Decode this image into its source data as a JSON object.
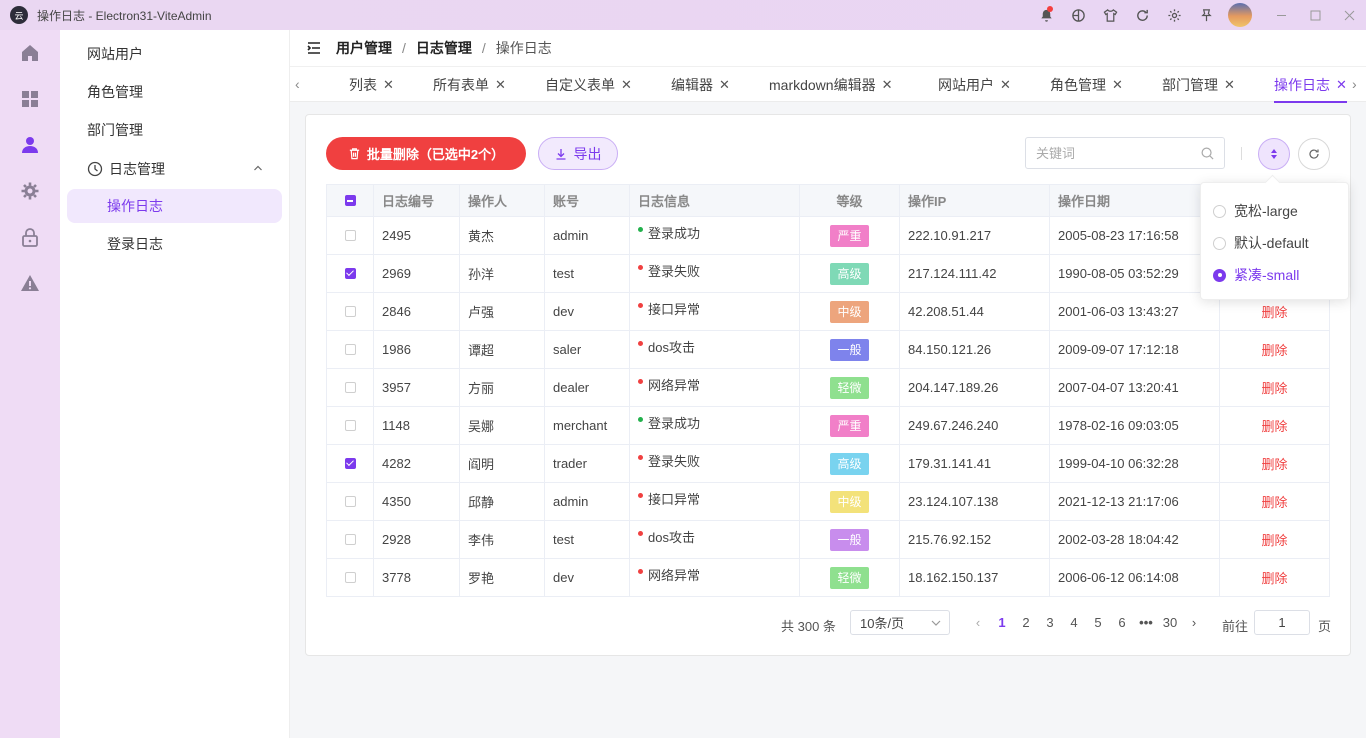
{
  "window": {
    "title": "操作日志 - Electron31-ViteAdmin",
    "logo_text": "云"
  },
  "titlebar_icons": [
    "bell-icon",
    "theme-icon",
    "shirt-icon",
    "refresh-icon",
    "gear-icon",
    "pin-icon"
  ],
  "rail": [
    "home-icon",
    "dashboard-icon",
    "user-icon",
    "gear-icon",
    "lock-icon",
    "warning-icon"
  ],
  "menu": {
    "items": [
      {
        "label": "网站用户"
      },
      {
        "label": "角色管理"
      },
      {
        "label": "部门管理"
      }
    ],
    "group": {
      "label": "日志管理",
      "expanded": true
    },
    "sub": [
      {
        "label": "操作日志",
        "active": true
      },
      {
        "label": "登录日志",
        "active": false
      }
    ]
  },
  "breadcrumb": [
    "用户管理",
    "日志管理",
    "操作日志"
  ],
  "tabs": [
    {
      "label": "列表",
      "active": false
    },
    {
      "label": "所有表单",
      "active": false
    },
    {
      "label": "自定义表单",
      "active": false
    },
    {
      "label": "编辑器",
      "active": false
    },
    {
      "label": "markdown编辑器",
      "active": false
    },
    {
      "label": "网站用户",
      "active": false
    },
    {
      "label": "角色管理",
      "active": false
    },
    {
      "label": "部门管理",
      "active": false
    },
    {
      "label": "操作日志",
      "active": true
    }
  ],
  "toolbar": {
    "delete_label": "批量删除（已选中2个）",
    "export_label": "导出",
    "search_placeholder": "关键词"
  },
  "table": {
    "columns": [
      "日志编号",
      "操作人",
      "账号",
      "日志信息",
      "等级",
      "操作IP",
      "操作日期"
    ],
    "rows": [
      {
        "id": "2495",
        "user": "黄杰",
        "account": "admin",
        "msg": "登录成功",
        "msg_color": "#22b14c",
        "level": "严重",
        "level_color": "#f17fc8",
        "ip": "222.10.91.217",
        "date": "2005-08-23 17:16:58",
        "checked": false,
        "action": ""
      },
      {
        "id": "2969",
        "user": "孙洋",
        "account": "test",
        "msg": "登录失败",
        "msg_color": "#f04040",
        "level": "高级",
        "level_color": "#7fd9b6",
        "ip": "217.124.111.42",
        "date": "1990-08-05 03:52:29",
        "checked": true,
        "action": ""
      },
      {
        "id": "2846",
        "user": "卢强",
        "account": "dev",
        "msg": "接口异常",
        "msg_color": "#f04040",
        "level": "中级",
        "level_color": "#eda57d",
        "ip": "42.208.51.44",
        "date": "2001-06-03 13:43:27",
        "checked": false,
        "action": "删除"
      },
      {
        "id": "1986",
        "user": "谭超",
        "account": "saler",
        "msg": "dos攻击",
        "msg_color": "#f04040",
        "level": "一般",
        "level_color": "#7e83ec",
        "ip": "84.150.121.26",
        "date": "2009-09-07 17:12:18",
        "checked": false,
        "action": "删除"
      },
      {
        "id": "3957",
        "user": "方丽",
        "account": "dealer",
        "msg": "网络异常",
        "msg_color": "#f04040",
        "level": "轻微",
        "level_color": "#8fe08f",
        "ip": "204.147.189.26",
        "date": "2007-04-07 13:20:41",
        "checked": false,
        "action": "删除"
      },
      {
        "id": "1148",
        "user": "吴娜",
        "account": "merchant",
        "msg": "登录成功",
        "msg_color": "#22b14c",
        "level": "严重",
        "level_color": "#f17fc8",
        "ip": "249.67.246.240",
        "date": "1978-02-16 09:03:05",
        "checked": false,
        "action": "删除"
      },
      {
        "id": "4282",
        "user": "阎明",
        "account": "trader",
        "msg": "登录失败",
        "msg_color": "#f04040",
        "level": "高级",
        "level_color": "#79d3ef",
        "ip": "179.31.141.41",
        "date": "1999-04-10 06:32:28",
        "checked": true,
        "action": "删除"
      },
      {
        "id": "4350",
        "user": "邱静",
        "account": "admin",
        "msg": "接口异常",
        "msg_color": "#f04040",
        "level": "中级",
        "level_color": "#f3e27a",
        "ip": "23.124.107.138",
        "date": "2021-12-13 21:17:06",
        "checked": false,
        "action": "删除"
      },
      {
        "id": "2928",
        "user": "李伟",
        "account": "test",
        "msg": "dos攻击",
        "msg_color": "#f04040",
        "level": "一般",
        "level_color": "#c88ded",
        "ip": "215.76.92.152",
        "date": "2002-03-28 18:04:42",
        "checked": false,
        "action": "删除"
      },
      {
        "id": "3778",
        "user": "罗艳",
        "account": "dev",
        "msg": "网络异常",
        "msg_color": "#f04040",
        "level": "轻微",
        "level_color": "#8fe08f",
        "ip": "18.162.150.137",
        "date": "2006-06-12 06:14:08",
        "checked": false,
        "action": "删除"
      }
    ]
  },
  "pagination": {
    "total": "共 300 条",
    "page_size": "10条/页",
    "pages": [
      "1",
      "2",
      "3",
      "4",
      "5",
      "6",
      "•••",
      "30"
    ],
    "current": "1",
    "goto_label": "前往",
    "goto_value": "1",
    "page_label": "页"
  },
  "size_popup": {
    "options": [
      {
        "label": "宽松-large",
        "selected": false
      },
      {
        "label": "默认-default",
        "selected": false
      },
      {
        "label": "紧凑-small",
        "selected": true
      }
    ]
  },
  "colors": {
    "accent": "#7c3aed",
    "danger": "#f04040",
    "rail_bg": "#efdcf5"
  }
}
